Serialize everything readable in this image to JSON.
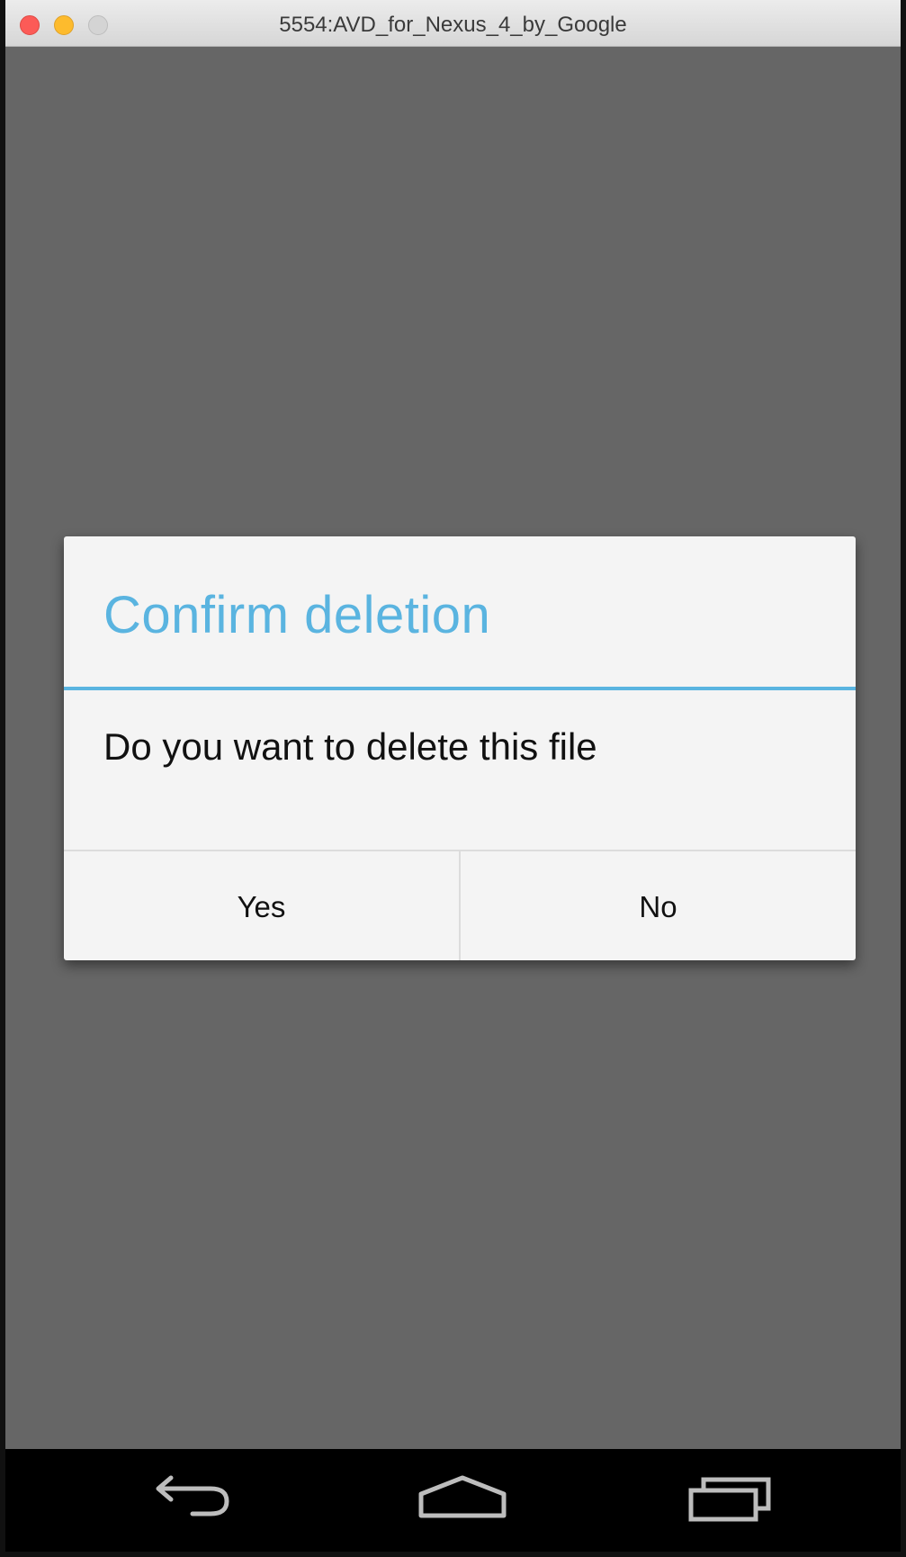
{
  "window": {
    "title": "5554:AVD_for_Nexus_4_by_Google",
    "controls": [
      "close-icon",
      "minimize-icon",
      "zoom-icon"
    ]
  },
  "dialog": {
    "title": "Confirm deletion",
    "message": "Do you want to delete this file",
    "positive_label": "Yes",
    "negative_label": "No",
    "accent_color": "#5ab4e0"
  },
  "navigation_bar": {
    "buttons": [
      "back-icon",
      "home-icon",
      "recents-icon"
    ]
  }
}
